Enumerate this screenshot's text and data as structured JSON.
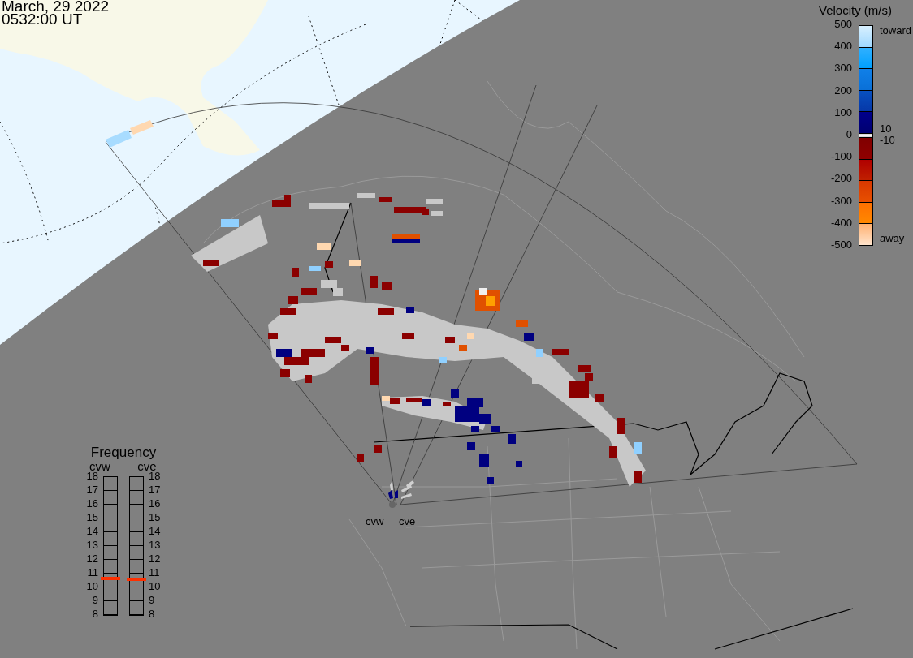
{
  "header": {
    "date": "March, 29 2022",
    "time": "0532:00 UT"
  },
  "velocity_legend": {
    "title": "Velocity (m/s)",
    "ticks": [
      "500",
      "400",
      "300",
      "200",
      "100",
      "0",
      "-100",
      "-200",
      "-300",
      "-400",
      "-500"
    ],
    "top_label": "toward",
    "upper_zero_label": "10",
    "lower_zero_label": "-10",
    "bottom_label": "away"
  },
  "frequency_legend": {
    "title": "Frequency",
    "radars": [
      {
        "name": "cvw",
        "kind": "left",
        "level": 0.265,
        "ticks": [
          "18",
          "17",
          "16",
          "15",
          "14",
          "13",
          "12",
          "11",
          "10",
          "9",
          "8"
        ]
      },
      {
        "name": "cve",
        "kind": "right",
        "level": 0.26,
        "ticks": [
          "18",
          "17",
          "16",
          "15",
          "14",
          "13",
          "12",
          "11",
          "10",
          "9",
          "8"
        ]
      }
    ]
  },
  "map": {
    "radar_labels": [
      "cvw",
      "cve"
    ]
  }
}
